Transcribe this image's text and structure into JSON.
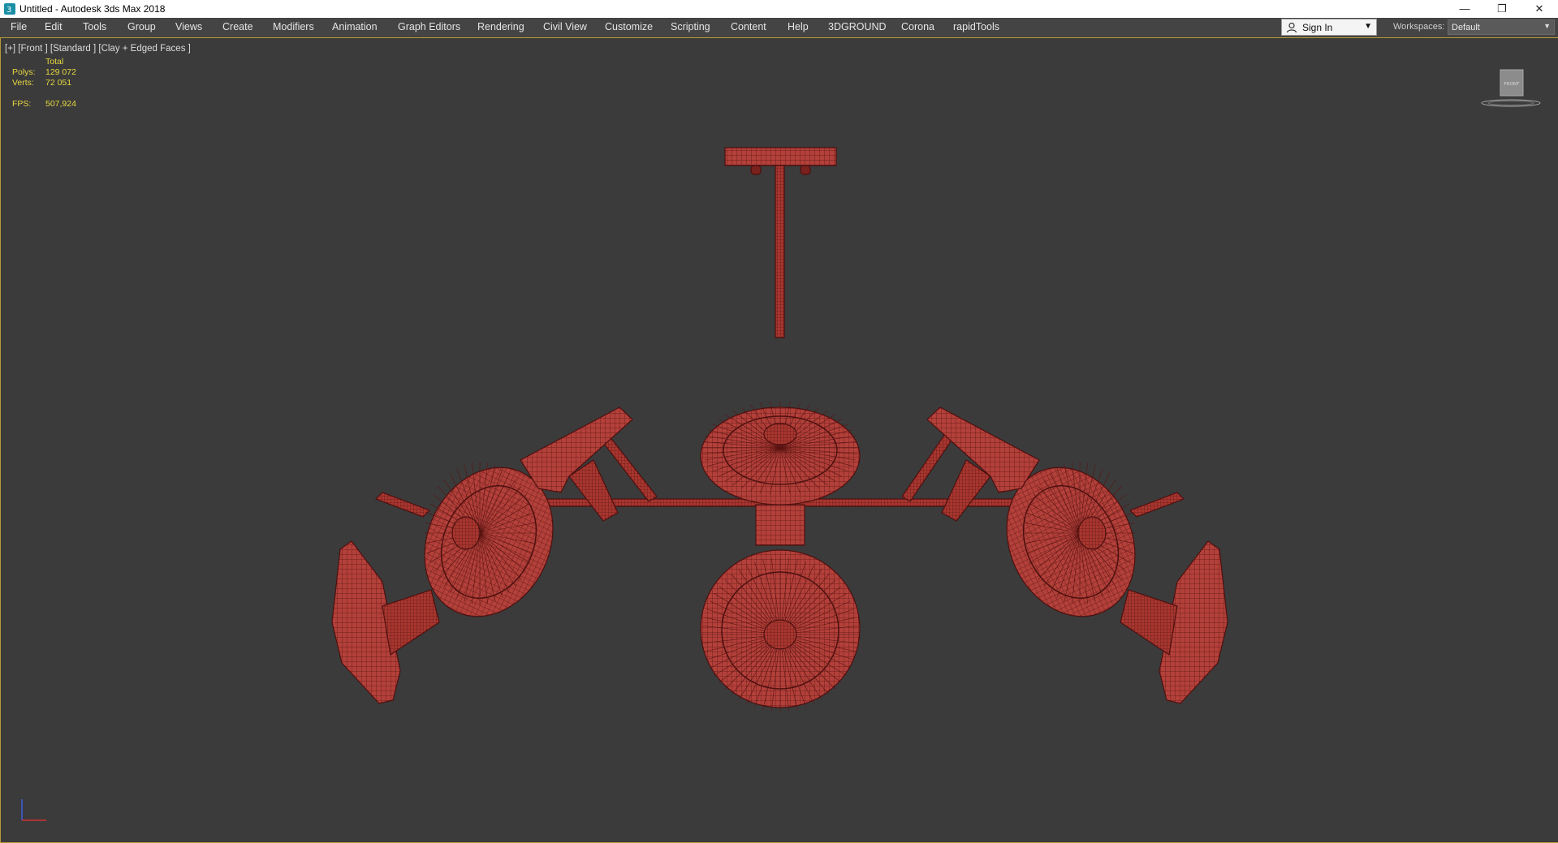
{
  "window": {
    "title": "Untitled - Autodesk 3ds Max 2018",
    "controls": {
      "minimize": "—",
      "maximize": "❐",
      "close": "✕"
    }
  },
  "menu": {
    "items": [
      "File",
      "Edit",
      "Tools",
      "Group",
      "Views",
      "Create",
      "Modifiers",
      "Animation",
      "Graph Editors",
      "Rendering",
      "Civil View",
      "Customize",
      "Scripting",
      "Content",
      "Help",
      "3DGROUND",
      "Corona",
      "rapidTools"
    ]
  },
  "account": {
    "sign_in_label": "Sign In"
  },
  "workspaces": {
    "label": "Workspaces:",
    "value": "Default"
  },
  "viewport": {
    "label": "[+] [Front ] [Standard ] [Clay + Edged Faces ]",
    "stats": {
      "total_label": "Total",
      "polys_label": "Polys:",
      "polys_value": "129 072",
      "verts_label": "Verts:",
      "verts_value": "72 051",
      "fps_label": "FPS:",
      "fps_value": "507,924"
    },
    "viewcube_label": "FRONT"
  },
  "colors": {
    "accent_border": "#b59a34",
    "stats_text": "#e8d840",
    "model_fill": "#b5403b",
    "model_wire": "#5a1412"
  }
}
